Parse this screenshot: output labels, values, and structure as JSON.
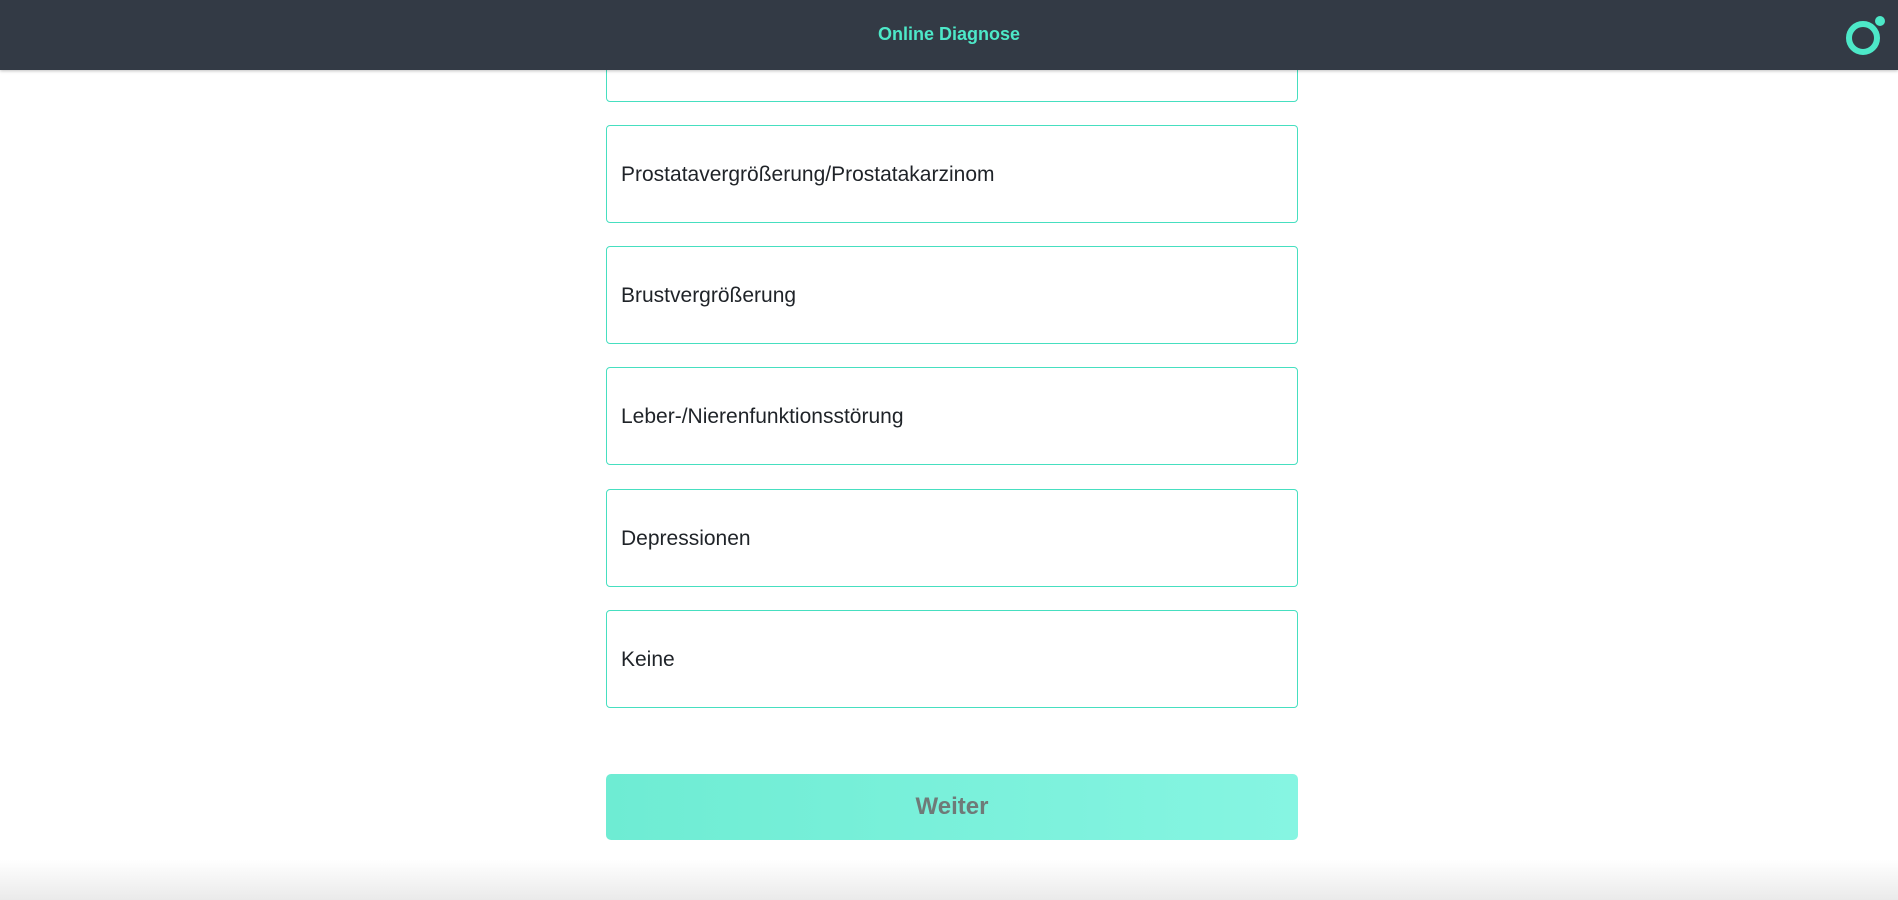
{
  "header": {
    "title": "Online Diagnose",
    "logo_icon": "ring-dot-logo-icon",
    "accent_color": "#4de8c8",
    "background_color": "#333a45"
  },
  "options": [
    {
      "label": ""
    },
    {
      "label": "Prostatavergrößerung/Prostatakarzinom"
    },
    {
      "label": "Brustvergrößerung"
    },
    {
      "label": "Leber-/Nierenfunktionsstörung"
    },
    {
      "label": "Depressionen"
    },
    {
      "label": "Keine"
    }
  ],
  "actions": {
    "next_label": "Weiter"
  }
}
